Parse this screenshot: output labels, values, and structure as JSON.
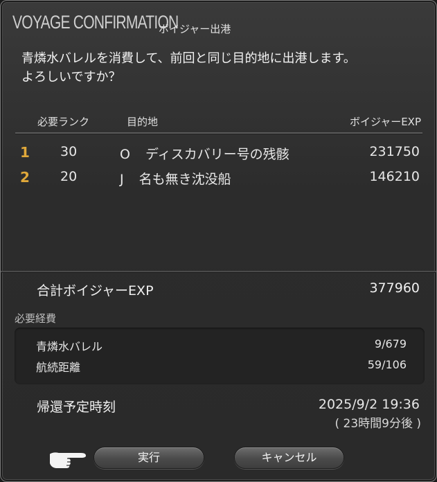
{
  "window": {
    "title": "VOYAGE CONFIRMATION",
    "subtitle": "ボイジャー出港"
  },
  "message": {
    "line1": "青燐水バレルを消費して、前回と同じ目的地に出港します。",
    "line2": "よろしいですか？"
  },
  "table": {
    "headers": {
      "rank": "必要ランク",
      "destination": "目的地",
      "exp": "ボイジャーEXP"
    },
    "rows": [
      {
        "num": "1",
        "rank": "30",
        "code": "O",
        "destination": "ディスカバリー号の残骸",
        "exp": "231750"
      },
      {
        "num": "2",
        "rank": "20",
        "code": "J",
        "destination": "名も無き沈没船",
        "exp": "146210"
      }
    ]
  },
  "total": {
    "label": "合計ボイジャーEXP",
    "value": "377960"
  },
  "costs": {
    "title": "必要経費",
    "items": [
      {
        "label": "青燐水バレル",
        "value": "9/679"
      },
      {
        "label": "航続距離",
        "value": "59/106"
      }
    ]
  },
  "eta": {
    "label": "帰還予定時刻",
    "datetime": "2025/9/2 19:36",
    "duration": "( 23時間9分後 )"
  },
  "buttons": {
    "execute": "実行",
    "cancel": "キャンセル"
  },
  "colors": {
    "accent_number": "#e0a83a",
    "background": "#2c2c2c",
    "text": "#f0f0f0"
  },
  "icons": {
    "cursor": "pointing-hand-icon"
  }
}
